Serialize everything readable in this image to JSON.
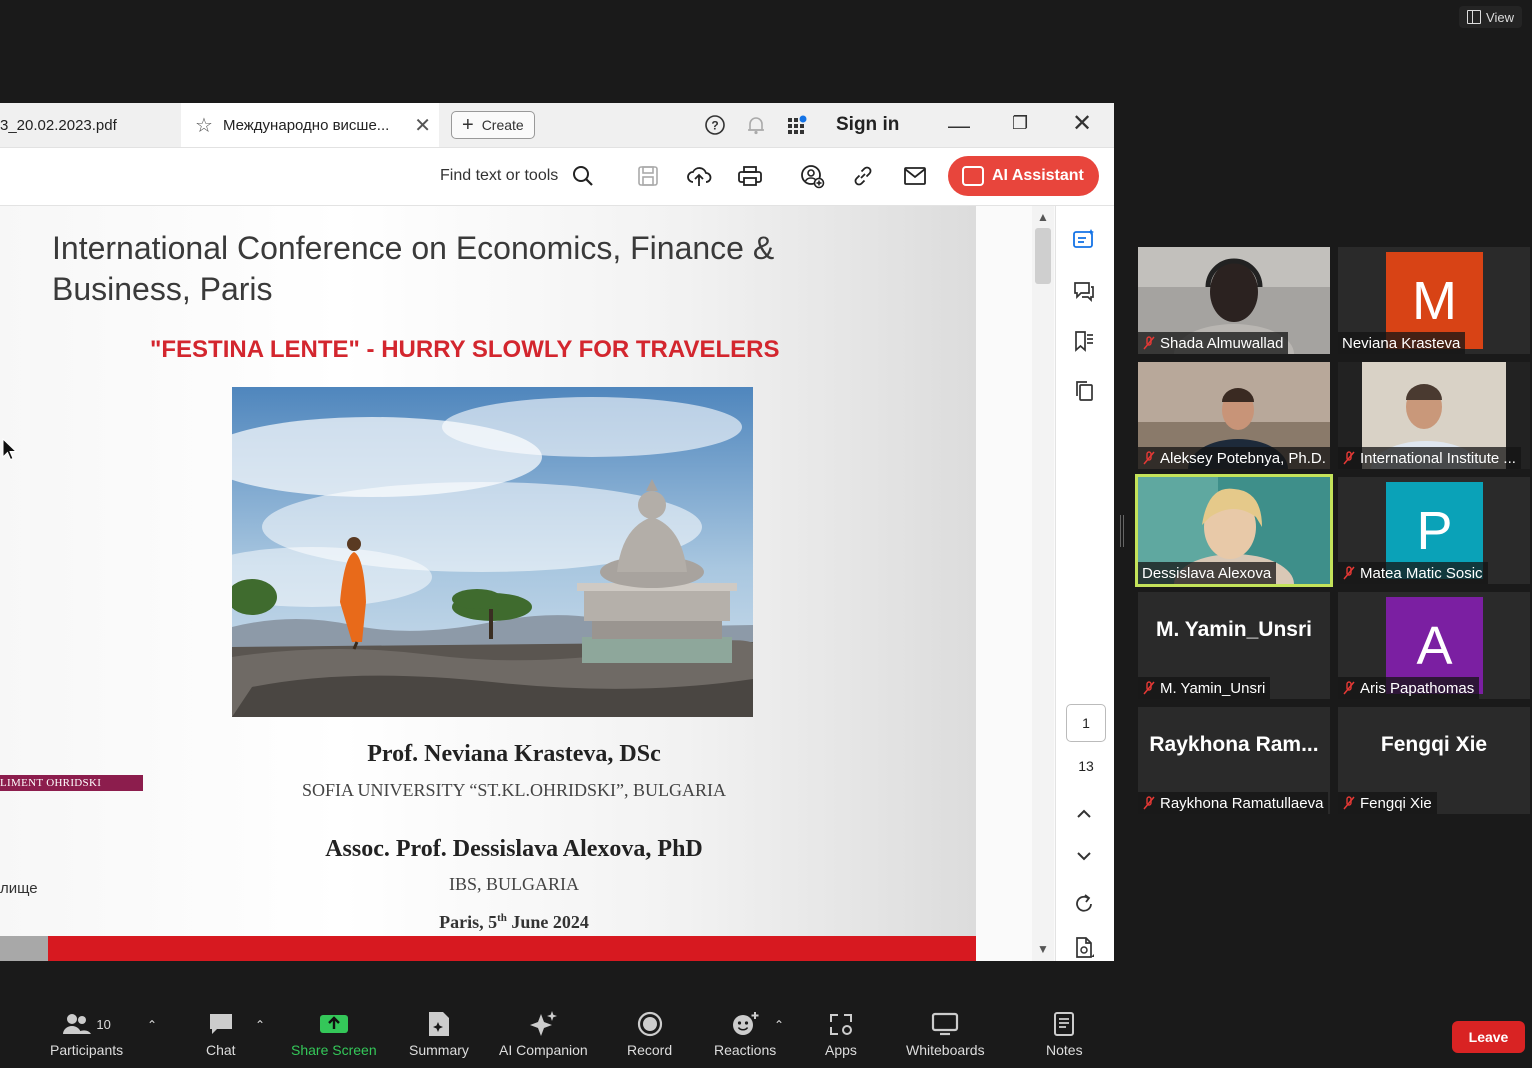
{
  "zoom": {
    "view_label": "View",
    "toolbar": {
      "participants_label": "Participants",
      "participants_count": "10",
      "chat_label": "Chat",
      "share_label": "Share Screen",
      "summary_label": "Summary",
      "companion_label": "AI Companion",
      "record_label": "Record",
      "reactions_label": "Reactions",
      "apps_label": "Apps",
      "whiteboards_label": "Whiteboards",
      "notes_label": "Notes",
      "leave_label": "Leave"
    },
    "participants": [
      {
        "name": "Shada Almuwallad",
        "big": ""
      },
      {
        "name": "Neviana Krasteva",
        "big": "",
        "initial": "M",
        "color": "#d84315"
      },
      {
        "name": "Aleksey Potebnya, Ph.D.",
        "big": ""
      },
      {
        "name": "International Institute ...",
        "big": ""
      },
      {
        "name": "Dessislava Alexova",
        "big": ""
      },
      {
        "name": "Matea Matic Sosic",
        "big": "",
        "initial": "P",
        "color": "#0aa2b8"
      },
      {
        "name": "M. Yamin_Unsri",
        "big": "M. Yamin_Unsri"
      },
      {
        "name": "Aris Papathomas",
        "big": "",
        "initial": "A",
        "color": "#7b1fa2"
      },
      {
        "name": "Raykhona Ramatullaeva",
        "big": "Raykhona  Ram..."
      },
      {
        "name": "Fengqi Xie",
        "big": "Fengqi Xie"
      }
    ]
  },
  "acrobat": {
    "tab1_label": "3_20.02.2023.pdf",
    "tab2_label": "Международно висше...",
    "create_label": "Create",
    "sign_in_label": "Sign in",
    "find_label": "Find text or tools",
    "ai_label": "AI Assistant",
    "page_current": "1",
    "page_total": "13"
  },
  "slide": {
    "title": "International Conference on Economics, Finance & Business, Paris",
    "subtitle": "\"FESTINA LENTE\" - HURRY SLOWLY FOR TRAVELERS",
    "author1": "Prof. Neviana Krasteva, DSc",
    "affiliation1": "SOFIA UNIVERSITY “ST.KL.OHRIDSKI”, BULGARIA",
    "author2": "Assoc. Prof. Dessislava Alexova, PhD",
    "affiliation2": "IBS, BULGARIA",
    "date_prefix": "Paris, 5",
    "date_sup": "th",
    "date_suffix": " June 2024",
    "logo_fragment": "LIMENT OHRIDSKI",
    "left_fragment": "лище"
  }
}
